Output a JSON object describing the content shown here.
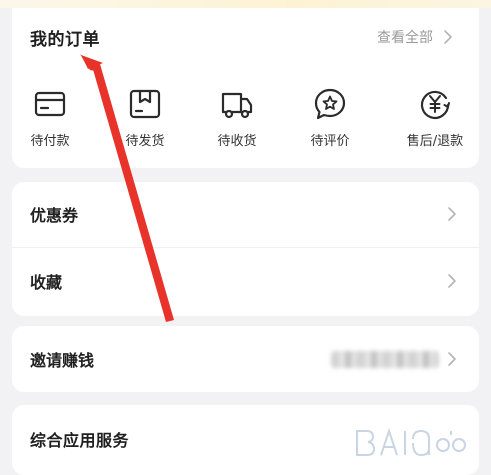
{
  "orders": {
    "title": "我的订单",
    "view_all": "查看全部",
    "items": [
      {
        "label": "待付款",
        "icon": "wallet-card-icon"
      },
      {
        "label": "待发货",
        "icon": "package-box-icon"
      },
      {
        "label": "待收货",
        "icon": "delivery-truck-icon"
      },
      {
        "label": "待评价",
        "icon": "review-star-bubble-icon"
      },
      {
        "label": "售后/退款",
        "icon": "refund-yuan-icon"
      }
    ]
  },
  "menu": {
    "coupons": "优惠券",
    "favorites": "收藏",
    "invite": "邀请赚钱",
    "services": "综合应用服务"
  },
  "colors": {
    "background": "#f2f2f4",
    "card": "#ffffff",
    "annotation_arrow": "#e8332a",
    "muted_text": "#9a9a9a"
  }
}
